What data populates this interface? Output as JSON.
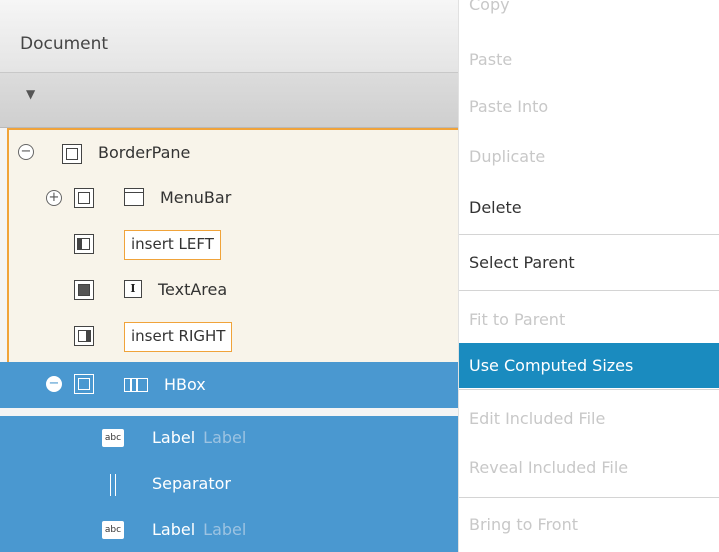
{
  "document_panel": {
    "title": "Document",
    "toolbar_arrow": "▼"
  },
  "tree": {
    "root": {
      "label": "BorderPane",
      "expander": "−"
    },
    "menubar": {
      "label": "MenuBar",
      "expander": "+"
    },
    "insert_left": "insert LEFT",
    "textarea": {
      "label": "TextArea",
      "icon_glyph": "I"
    },
    "insert_right": "insert RIGHT",
    "hbox": {
      "label": "HBox",
      "expander": "−"
    },
    "children": [
      {
        "label": "Label",
        "ghost": "Label",
        "icon": "abc"
      },
      {
        "label": "Separator"
      },
      {
        "label": "Label",
        "ghost": "Label",
        "icon": "abc"
      }
    ]
  },
  "context_menu": {
    "items": [
      {
        "label": "Copy",
        "state": "disabled"
      },
      {
        "label": "Paste",
        "state": "disabled"
      },
      {
        "label": "Paste Into",
        "state": "disabled"
      },
      {
        "label": "Duplicate",
        "state": "disabled"
      },
      {
        "label": "Delete",
        "state": "enabled"
      },
      {
        "label": "Select Parent",
        "state": "enabled"
      },
      {
        "label": "Fit to Parent",
        "state": "disabled"
      },
      {
        "label": "Use Computed Sizes",
        "state": "highlighted"
      },
      {
        "label": "Edit Included File",
        "state": "disabled"
      },
      {
        "label": "Reveal Included File",
        "state": "disabled"
      },
      {
        "label": "Bring to Front",
        "state": "disabled"
      }
    ]
  },
  "colors": {
    "selection_blue": "#4a98d0",
    "menu_highlight": "#1a8bbf",
    "insert_orange": "#f0a33a"
  }
}
